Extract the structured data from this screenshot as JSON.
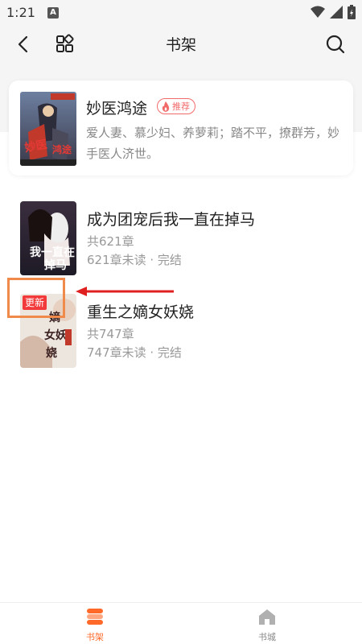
{
  "status_bar": {
    "time": "1:21",
    "notification_badge": "A"
  },
  "nav": {
    "title": "书架"
  },
  "recommend": {
    "title": "妙医鸿途",
    "badge": "推荐",
    "description": "爱人妻、慕少妇、养萝莉；踏不平，撩群芳，妙手医人济世。"
  },
  "books": [
    {
      "title": "成为团宠后我一直在掉马",
      "chapters": "共621章",
      "progress": "621章未读 · 完结"
    },
    {
      "title": "重生之嫡女妖娆",
      "chapters": "共747章",
      "progress": "747章未读 · 完结",
      "tag": "更新"
    }
  ],
  "tabs": [
    {
      "label": "书架",
      "active": true,
      "icon": "bookshelf-icon"
    },
    {
      "label": "书城",
      "active": false,
      "icon": "home-icon"
    }
  ],
  "colors": {
    "accent": "#ff6a2b",
    "badge": "#f26b6b",
    "update": "#f23a3a",
    "highlight": "#f08a4a",
    "arrow": "#e02020"
  }
}
